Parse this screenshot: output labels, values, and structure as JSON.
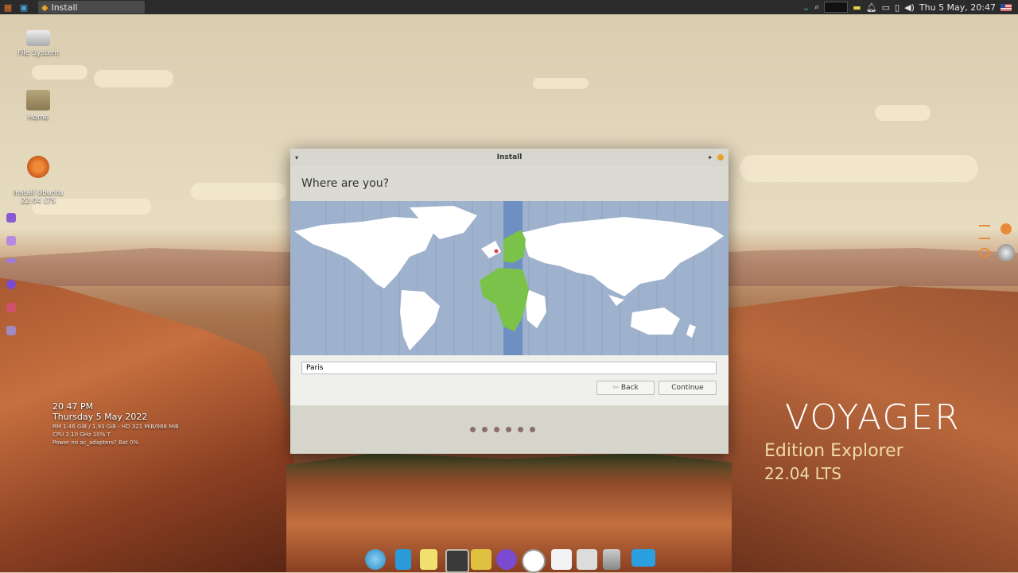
{
  "topbar": {
    "task_title": "Install",
    "datetime": "Thu 5 May, 20:47"
  },
  "desktop": {
    "icons": [
      {
        "label": "File System",
        "icon": "drive-icon"
      },
      {
        "label": "Home",
        "icon": "home-folder-icon"
      },
      {
        "label": "Install Ubuntu\n22.04 LTS",
        "icon": "ubuntu-installer-icon"
      }
    ]
  },
  "conky": {
    "time": "20 47 PM",
    "date": "Thursday  5 May 2022",
    "line1": "RM 1.46 GiB / 1.93 GiB - HD 321 MiB/988 MiB",
    "line2": "CPU 2.10 GHz 10% T",
    "line3": "Power no ac_adapters? Bat 0%"
  },
  "branding": {
    "title": "VOYAGER",
    "edition": "Edition Explorer",
    "version": "22.04 LTS"
  },
  "window": {
    "title": "Install",
    "heading": "Where are you?",
    "location_value": "Paris",
    "back_label": "Back",
    "continue_label": "Continue",
    "progress_dots": 6
  },
  "colors": {
    "selected_zone": "#7ac24a",
    "map_ocean": "#9fb2cd",
    "map_land": "#ffffff",
    "accent": "#e8a128"
  }
}
